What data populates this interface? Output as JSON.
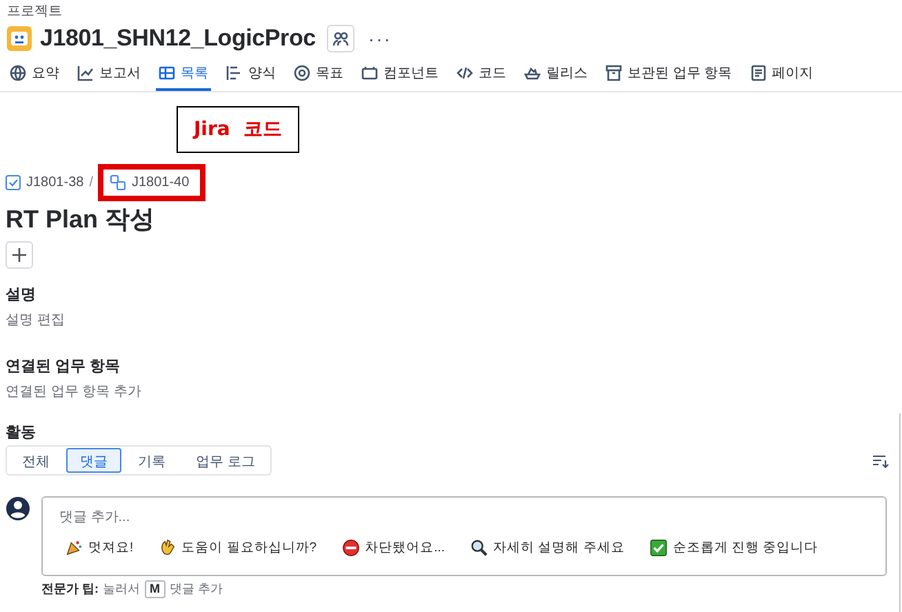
{
  "breadcrumb_label": "프로젝트",
  "project": {
    "name": "J1801_SHN12_LogicProc",
    "more": "···"
  },
  "nav_tabs": [
    {
      "label": "요약",
      "kind": "globe",
      "selected": false
    },
    {
      "label": "보고서",
      "kind": "chart",
      "selected": false
    },
    {
      "label": "목록",
      "kind": "table",
      "selected": true
    },
    {
      "label": "양식",
      "kind": "form",
      "selected": false
    },
    {
      "label": "목표",
      "kind": "target",
      "selected": false
    },
    {
      "label": "컴포넌트",
      "kind": "component",
      "selected": false
    },
    {
      "label": "코드",
      "kind": "code",
      "selected": false
    },
    {
      "label": "릴리스",
      "kind": "ship",
      "selected": false
    },
    {
      "label": "보관된 업무 항목",
      "kind": "archive",
      "selected": false
    },
    {
      "label": "페이지",
      "kind": "page",
      "selected": false
    }
  ],
  "annotation": {
    "label": "Jira  코드"
  },
  "issue": {
    "parent_key": "J1801-38",
    "separator": "/",
    "key": "J1801-40",
    "title": "RT Plan 작성"
  },
  "sections": [
    {
      "heading": "설명",
      "action": "설명 편집"
    },
    {
      "heading": "연결된 업무 항목",
      "action": "연결된 업무 항목 추가"
    }
  ],
  "activity": {
    "heading": "활동",
    "filters": [
      {
        "label": "전체",
        "selected": false
      },
      {
        "label": "댓글",
        "selected": true
      },
      {
        "label": "기록",
        "selected": false
      },
      {
        "label": "업무 로그",
        "selected": false
      }
    ]
  },
  "comment": {
    "placeholder": "댓글 추가...",
    "quick_replies": [
      {
        "label": "멋져요!",
        "kind": "party"
      },
      {
        "label": "도움이 필요하십니까?",
        "kind": "hand"
      },
      {
        "label": "차단됐어요...",
        "kind": "blocked"
      },
      {
        "label": "자세히 설명해 주세요",
        "kind": "magnifier"
      },
      {
        "label": "순조롭게 진행 중입니다",
        "kind": "check"
      }
    ],
    "tip": {
      "label": "전문가 팁:",
      "before": "눌러서",
      "key": "M",
      "after": "댓글 추가"
    }
  }
}
